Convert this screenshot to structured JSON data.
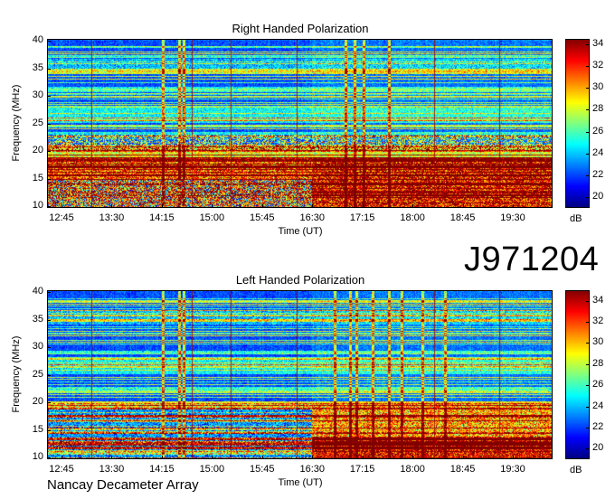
{
  "id_label": "J971204",
  "footer": "Nancay Decameter Array",
  "chart_data": [
    {
      "type": "heatmap",
      "title": "Right Handed Polarization",
      "xlabel": "Time (UT)",
      "ylabel": "Frequency (MHz)",
      "x_ticks": [
        "12:45",
        "13:30",
        "14:15",
        "15:00",
        "15:45",
        "16:30",
        "17:15",
        "18:00",
        "18:45",
        "19:30"
      ],
      "y_ticks": [
        10,
        15,
        20,
        25,
        30,
        35,
        40
      ],
      "ylim": [
        10,
        40
      ],
      "colorbar": {
        "label": "dB",
        "ticks": [
          20,
          22,
          24,
          26,
          28,
          30,
          32,
          34
        ],
        "range": [
          19,
          34.5
        ]
      }
    },
    {
      "type": "heatmap",
      "title": "Left Handed Polarization",
      "xlabel": "Time (UT)",
      "ylabel": "Frequency (MHz)",
      "x_ticks": [
        "12:45",
        "13:30",
        "14:15",
        "15:00",
        "15:45",
        "16:30",
        "17:15",
        "18:00",
        "18:45",
        "19:30"
      ],
      "y_ticks": [
        10,
        15,
        20,
        25,
        30,
        35,
        40
      ],
      "ylim": [
        10,
        40
      ],
      "colorbar": {
        "label": "dB",
        "ticks": [
          20,
          22,
          24,
          26,
          28,
          30,
          32,
          34
        ],
        "range": [
          19,
          35
        ]
      }
    }
  ]
}
